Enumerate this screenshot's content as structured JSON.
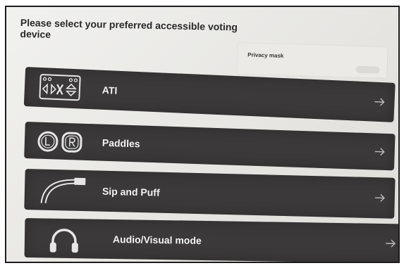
{
  "page": {
    "title": "Please select your preferred accessible voting device"
  },
  "privacy": {
    "label": "Privacy mask"
  },
  "options": [
    {
      "label": "ATI",
      "icon": "ati-keypad-icon"
    },
    {
      "label": "Paddles",
      "icon": "paddles-icon"
    },
    {
      "label": "Sip and Puff",
      "icon": "sip-and-puff-icon"
    },
    {
      "label": "Audio/Visual mode",
      "icon": "headphones-icon"
    }
  ],
  "colors": {
    "option_background": "#3b3939",
    "option_text": "#f2f2f2",
    "screen_background": "#e7e6e3"
  }
}
